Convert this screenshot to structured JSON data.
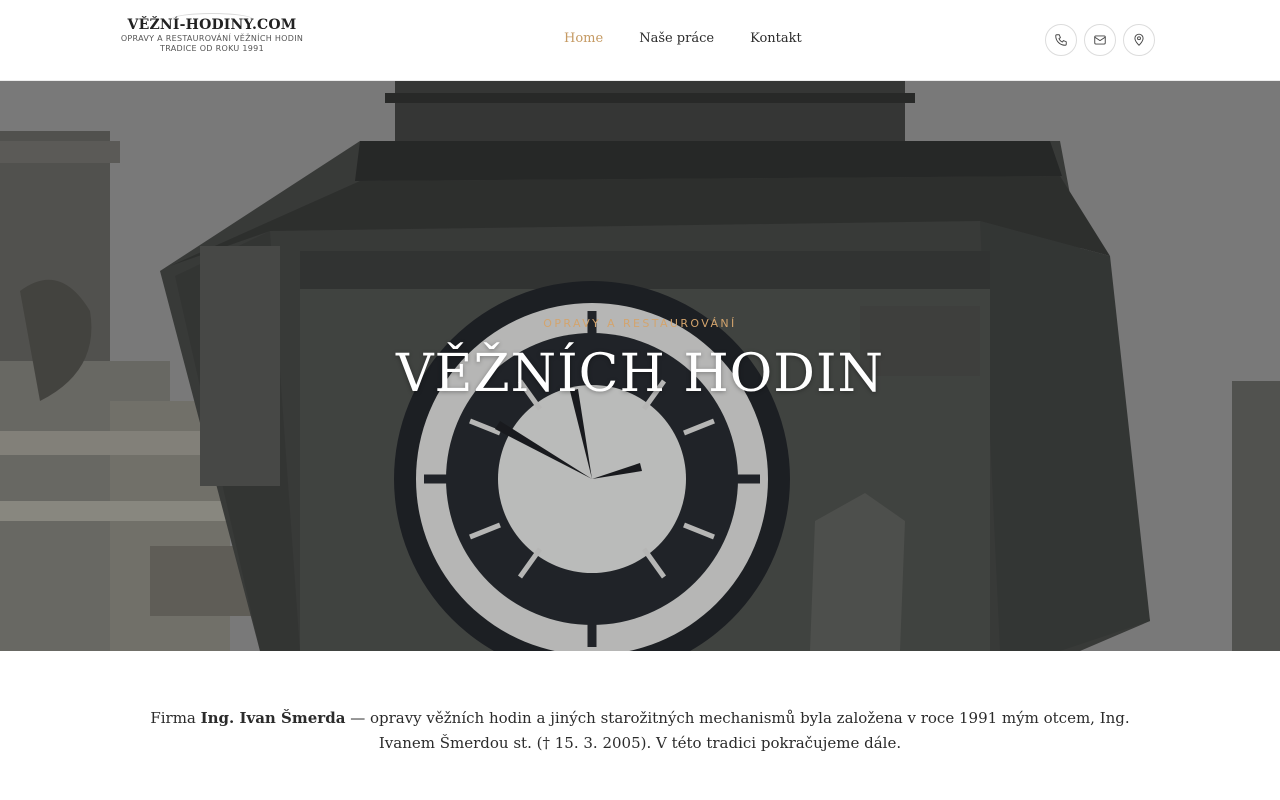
{
  "logo": {
    "title": "VĚŽNÍ-HODINY.COM",
    "subtitle_line1": "OPRAVY A RESTAUROVÁNÍ VĚŽNÍCH HODIN",
    "subtitle_line2": "TRADICE OD ROKU 1991"
  },
  "nav": {
    "items": [
      {
        "label": "Home",
        "active": true
      },
      {
        "label": "Naše práce",
        "active": false
      },
      {
        "label": "Kontakt",
        "active": false
      }
    ]
  },
  "header_icons": [
    "phone-icon",
    "mail-icon",
    "location-pin-icon"
  ],
  "hero": {
    "kicker": "OPRAVY A RESTAUROVÁNÍ",
    "title": "VĚŽNÍCH HODIN"
  },
  "intro": {
    "prefix": "Firma ",
    "company": "Ing. Ivan Šmerda",
    "rest": " — opravy věžních hodin a jiných starožitných mechanismů byla založena v roce 1991 mým otcem, Ing. Ivanem Šmerdou st. († 15. 3. 2005). V této tradici pokračujeme dále."
  },
  "colors": {
    "accent": "#c59a63",
    "kicker": "#d3a46d"
  }
}
